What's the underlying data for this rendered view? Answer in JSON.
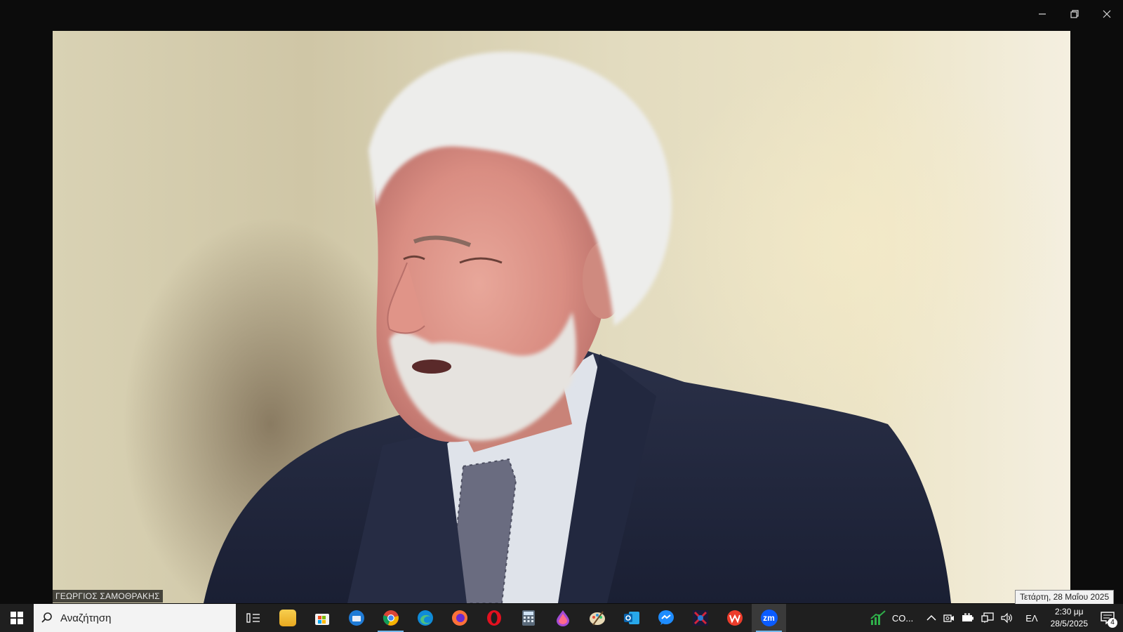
{
  "video": {
    "participant_name": "ΓΕΩΡΓΙΟΣ ΣΑΜΟΘΡΑΚΗΣ"
  },
  "tooltip": {
    "date_text": "Τετάρτη, 28 Μαΐου 2025"
  },
  "taskbar": {
    "search_placeholder": "Αναζήτηση",
    "apps": [
      {
        "name": "task-view"
      },
      {
        "name": "file-explorer"
      },
      {
        "name": "microsoft-store"
      },
      {
        "name": "thunderbird"
      },
      {
        "name": "chrome",
        "running": true
      },
      {
        "name": "edge"
      },
      {
        "name": "firefox"
      },
      {
        "name": "opera"
      },
      {
        "name": "calculator"
      },
      {
        "name": "color-drop-app"
      },
      {
        "name": "paint"
      },
      {
        "name": "outlook"
      },
      {
        "name": "messenger"
      },
      {
        "name": "opap"
      },
      {
        "name": "wps-office"
      },
      {
        "name": "zoom",
        "label": "zm",
        "active": true
      }
    ],
    "stock_widget_label": "CO...",
    "language": "ΕΛ",
    "clock": {
      "time": "2:30 μμ",
      "date": "28/5/2025"
    },
    "notification_count": "4"
  },
  "colors": {
    "taskbar_bg": "#1f1f1f",
    "accent": "#76b9ed",
    "zoom_blue": "#0b5cff"
  }
}
